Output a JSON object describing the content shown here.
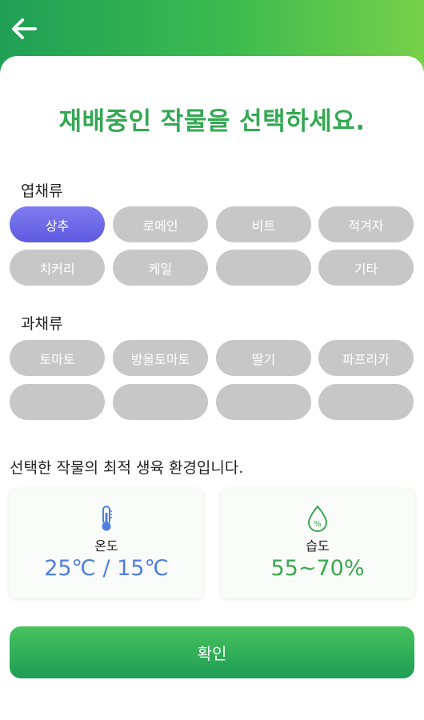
{
  "header": {
    "back_icon": "arrow-left-icon"
  },
  "title": "재배중인 작물을 선택하세요.",
  "sections": {
    "leafy": {
      "label": "엽채류",
      "chips": [
        "상추",
        "로메인",
        "비트",
        "적겨자",
        "치커리",
        "케일",
        "",
        "기타"
      ],
      "selected": "상추"
    },
    "fruit": {
      "label": "과채류",
      "chips": [
        "토마토",
        "방울토마토",
        "딸기",
        "파프리카",
        "",
        "",
        "",
        ""
      ]
    }
  },
  "environment": {
    "label": "선택한 작물의 최적 생육 환경입니다.",
    "temperature": {
      "name": "온도",
      "value": "25℃ / 15℃",
      "icon": "thermometer-icon"
    },
    "humidity": {
      "name": "습도",
      "value": "55~70%",
      "icon": "humidity-drop-icon"
    }
  },
  "confirm_label": "확인",
  "colors": {
    "accent_green": "#34a853",
    "selected_chip": "#6a67e8",
    "chip_gray": "#c7c7c7",
    "temperature_blue": "#4f7ee0",
    "humidity_green": "#39a84f"
  }
}
